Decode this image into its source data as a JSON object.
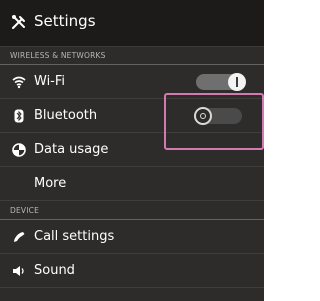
{
  "header": {
    "title": "Settings",
    "icon": "tools-icon"
  },
  "sections": {
    "wireless": "WIRELESS & NETWORKS",
    "device": "DEVICE"
  },
  "items": {
    "wifi": {
      "label": "Wi-Fi",
      "icon": "wifi-icon",
      "toggle": "on"
    },
    "bluetooth": {
      "label": "Bluetooth",
      "icon": "bluetooth-icon",
      "toggle": "off"
    },
    "data_usage": {
      "label": "Data usage",
      "icon": "pie-chart-icon"
    },
    "more": {
      "label": "More"
    },
    "call_settings": {
      "label": "Call settings",
      "icon": "phone-icon"
    },
    "sound": {
      "label": "Sound",
      "icon": "speaker-icon"
    }
  },
  "colors": {
    "background": "#2d2c2a",
    "header": "#1c1b1a",
    "highlight": "#d37bb0"
  }
}
